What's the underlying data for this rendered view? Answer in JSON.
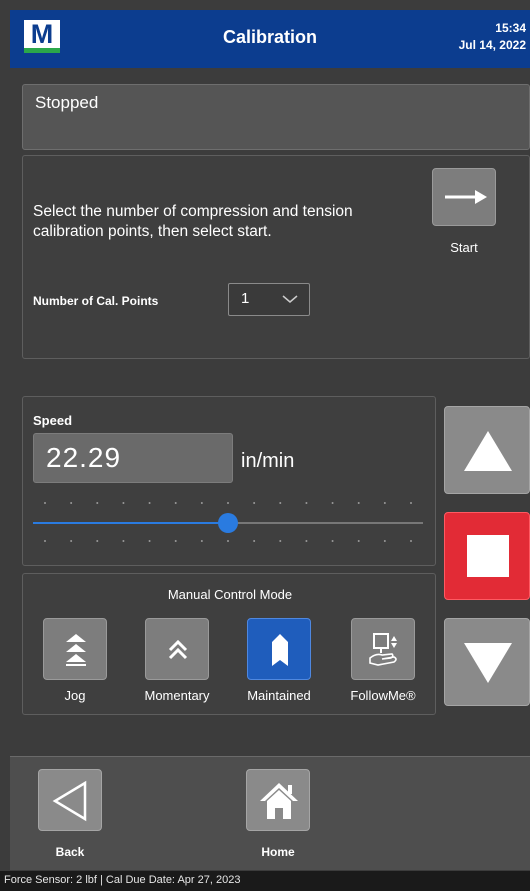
{
  "header": {
    "logo_letter": "M",
    "title": "Calibration",
    "time": "15:34",
    "date": "Jul 14, 2022",
    "colors": {
      "bar": "#0c3d8f",
      "logo_accent": "#2ba84a"
    }
  },
  "status": {
    "text": "Stopped"
  },
  "calibration": {
    "instructions": "Select the number of compression and tension calibration points, then select start.",
    "start_label": "Start",
    "start_icon": "arrow-right-icon",
    "num_points_label": "Number of Cal. Points",
    "num_points_value": "1"
  },
  "speed": {
    "label": "Speed",
    "value": "22.29",
    "unit": "in/min",
    "slider_fraction": 0.5
  },
  "manual_mode": {
    "title": "Manual Control Mode",
    "modes": [
      {
        "label": "Jog",
        "icon": "jog-icon",
        "active": false
      },
      {
        "label": "Momentary",
        "icon": "momentary-icon",
        "active": false
      },
      {
        "label": "Maintained",
        "icon": "maintained-icon",
        "active": true
      },
      {
        "label": "FollowMe®",
        "icon": "followme-icon",
        "active": false
      }
    ]
  },
  "jog_controls": {
    "up_icon": "triangle-up-icon",
    "stop_icon": "stop-square-icon",
    "down_icon": "triangle-down-icon",
    "stop_color": "#e22b36"
  },
  "nav": {
    "back_label": "Back",
    "home_label": "Home"
  },
  "footer": {
    "text": "Force Sensor: 2 lbf  |  Cal Due Date: Apr 27, 2023"
  }
}
